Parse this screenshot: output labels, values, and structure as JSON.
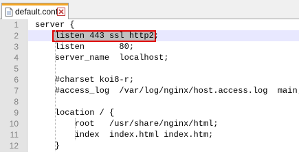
{
  "tab": {
    "file_name": "default.conf"
  },
  "editor": {
    "lines": [
      {
        "number": "1",
        "text": "server {"
      },
      {
        "number": "2",
        "text": "    listen 443 ssl http2;"
      },
      {
        "number": "3",
        "text": "    listen       80;"
      },
      {
        "number": "4",
        "text": "    server_name  localhost;"
      },
      {
        "number": "5",
        "text": ""
      },
      {
        "number": "6",
        "text": "    #charset koi8-r;"
      },
      {
        "number": "7",
        "text": "    #access_log  /var/log/nginx/host.access.log  main;"
      },
      {
        "number": "8",
        "text": ""
      },
      {
        "number": "9",
        "text": "    location / {"
      },
      {
        "number": "10",
        "text": "        root   /usr/share/nginx/html;"
      },
      {
        "number": "11",
        "text": "        index  index.html index.htm;"
      },
      {
        "number": "12",
        "text": "    }"
      }
    ],
    "current_line": 2
  },
  "colors": {
    "highlight_border": "#e00000",
    "current_line_bg": "#e8e8ff",
    "tab_accent": "#f5a623"
  }
}
